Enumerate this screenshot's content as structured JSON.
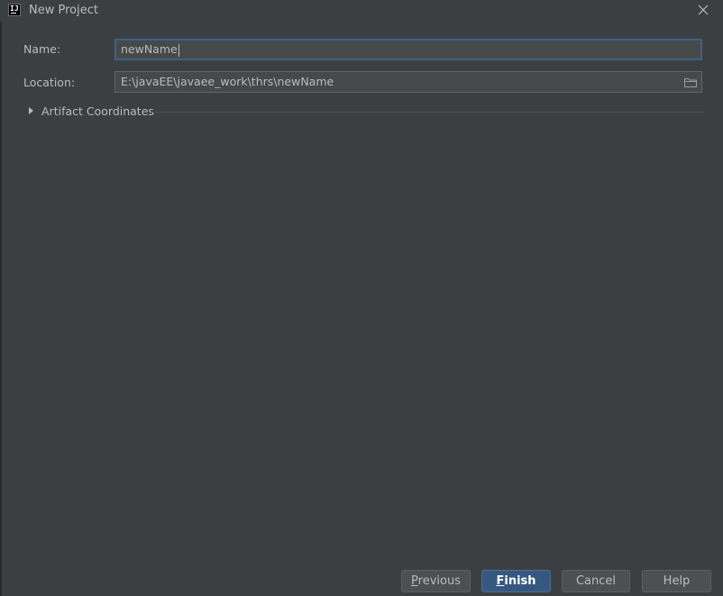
{
  "window": {
    "title": "New Project",
    "logo_text": "IJ"
  },
  "form": {
    "name_label": "Name:",
    "name_value": "newName",
    "location_label": "Location:",
    "location_value": "E:\\javaEE\\javaee_work\\thrs\\newName"
  },
  "sections": {
    "artifact_label": "Artifact Coordinates"
  },
  "buttons": {
    "previous_mnemonic": "P",
    "previous_rest": "revious",
    "finish_mnemonic": "F",
    "finish_rest": "inish",
    "cancel": "Cancel",
    "help": "Help"
  },
  "colors": {
    "background": "#3c3f41",
    "accent": "#365880",
    "focus_border": "#3d6185"
  },
  "icons": {
    "close": "close-icon",
    "folder": "folder-icon",
    "expand": "triangle-right-icon"
  }
}
